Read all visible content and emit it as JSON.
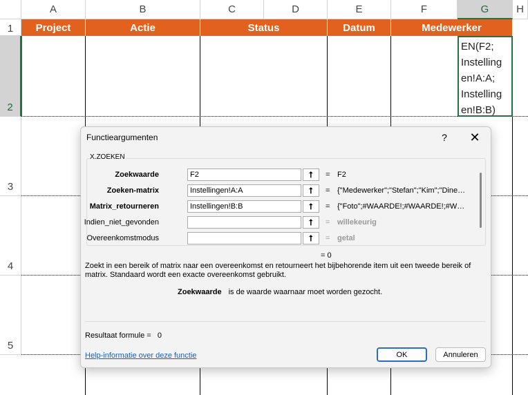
{
  "columns": [
    "A",
    "B",
    "C",
    "D",
    "E",
    "F",
    "G",
    "H"
  ],
  "selected_column": "G",
  "rows": [
    "1",
    "2",
    "3",
    "4",
    "5"
  ],
  "selected_row": "2",
  "header_row": [
    "Project",
    "Actie",
    "Status",
    "Datum",
    "Medewerker"
  ],
  "cell_g2_lines": [
    "EN(F2;",
    "Instelling",
    "en!A:A;",
    "Instelling",
    "en!B:B)"
  ],
  "colors": {
    "header_fill": "#e2611f",
    "selection": "#217346",
    "link": "#1a5fb4"
  },
  "dialog": {
    "title": "Functieargumenten",
    "help_button": "?",
    "close_button": "✕",
    "function_name": "X.ZOEKEN",
    "arguments": [
      {
        "label": "Zoekwaarde",
        "bold": true,
        "value": "F2",
        "result": "F2"
      },
      {
        "label": "Zoeken-matrix",
        "bold": true,
        "value": "Instellingen!A:A",
        "result": "{\"Medewerker\";\"Stefan\";\"Kim\";\"Dine…"
      },
      {
        "label": "Matrix_retourneren",
        "bold": true,
        "value": "Instellingen!B:B",
        "result": "{\"Foto\";#WAARDE!;#WAARDE!;#W…"
      },
      {
        "label": "Indien_niet_gevonden",
        "bold": false,
        "value": "",
        "result": "willekeurig"
      },
      {
        "label": "Overeenkomstmodus",
        "bold": false,
        "value": "",
        "result": "getal"
      }
    ],
    "collapse_icon": "⭡",
    "result_value": "= 0",
    "description": "Zoekt in een bereik of matrix naar een overeenkomst en retourneert het bijbehorende item uit een tweede bereik of matrix. Standaard wordt een exacte overeenkomst gebruikt.",
    "arg_desc_name": "Zoekwaarde",
    "arg_desc_text": "is de waarde waarnaar moet worden gezocht.",
    "formula_result": "Resultaat formule =   0",
    "help_link": "Help-informatie over deze functie",
    "ok_label": "OK",
    "cancel_label": "Annuleren"
  }
}
